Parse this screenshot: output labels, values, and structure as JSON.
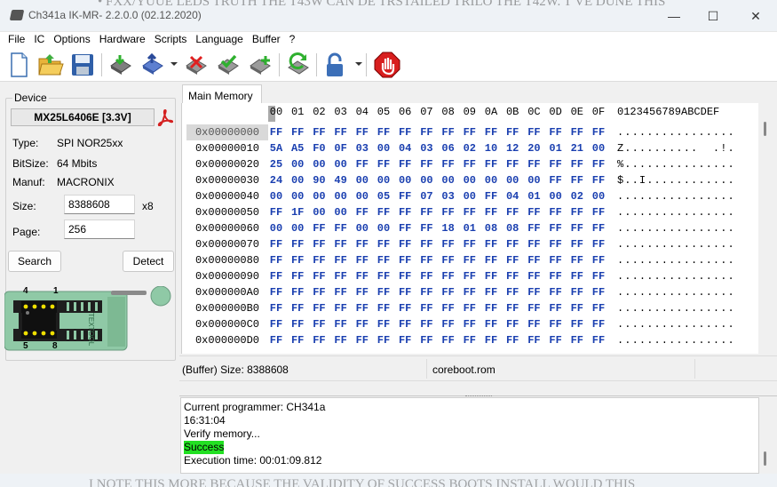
{
  "window": {
    "title": "Ch341a IK-MR- 2.2.0.0 (02.12.2020)",
    "bg_text_top": "• FXX/YUUE LEDS TRUTH THE T43W CAN DE TRSTAILED TRILO THE T42W. T VE DUNE THIS",
    "bg_text_bottom": "I NOTE THIS MORE BECAUSE THE VALIDITY OF SUCCESS BOOTS INSTALL WOULD THIS"
  },
  "menu": [
    "File",
    "IC",
    "Options",
    "Hardware",
    "Scripts",
    "Language",
    "Buffer",
    "?"
  ],
  "toolbar": {
    "icons": [
      "new-file-icon",
      "open-file-icon",
      "save-icon",
      "read-chip-icon",
      "write-chip-icon",
      "erase-chip-icon",
      "verify-chip-icon",
      "blank-check-icon",
      "auto-icon",
      "lock-icon",
      "stop-icon"
    ]
  },
  "device": {
    "legend": "Device",
    "chip": "MX25L6406E [3.3V]",
    "type_label": "Type:",
    "type_value": "SPI NOR",
    "type_suffix": "25xx",
    "bitsize_label": "BitSize:",
    "bitsize_value": "64 Mbits",
    "manuf_label": "Manuf:",
    "manuf_value": "MACRONIX",
    "size_label": "Size:",
    "size_value": "8388608",
    "size_mult": "x8",
    "page_label": "Page:",
    "page_value": "256",
    "search_button": "Search",
    "detect_button": "Detect",
    "socket": {
      "pin4": "4",
      "pin1": "1",
      "pin5": "5",
      "pin8": "8",
      "brand": "TEXTOOL"
    }
  },
  "tabs": [
    "Main Memory"
  ],
  "hex": {
    "columns": [
      "00",
      "01",
      "02",
      "03",
      "04",
      "05",
      "06",
      "07",
      "08",
      "09",
      "0A",
      "0B",
      "0C",
      "0D",
      "0E",
      "0F"
    ],
    "ascii_header": "0123456789ABCDEF",
    "rows": [
      {
        "addr": "0x00000000",
        "bytes": [
          "FF",
          "FF",
          "FF",
          "FF",
          "FF",
          "FF",
          "FF",
          "FF",
          "FF",
          "FF",
          "FF",
          "FF",
          "FF",
          "FF",
          "FF",
          "FF"
        ],
        "ascii": "................"
      },
      {
        "addr": "0x00000010",
        "bytes": [
          "5A",
          "A5",
          "F0",
          "0F",
          "03",
          "00",
          "04",
          "03",
          "06",
          "02",
          "10",
          "12",
          "20",
          "01",
          "21",
          "00"
        ],
        "ascii": "Z..........  .!."
      },
      {
        "addr": "0x00000020",
        "bytes": [
          "25",
          "00",
          "00",
          "00",
          "FF",
          "FF",
          "FF",
          "FF",
          "FF",
          "FF",
          "FF",
          "FF",
          "FF",
          "FF",
          "FF",
          "FF"
        ],
        "ascii": "%..............."
      },
      {
        "addr": "0x00000030",
        "bytes": [
          "24",
          "00",
          "90",
          "49",
          "00",
          "00",
          "00",
          "00",
          "00",
          "00",
          "00",
          "00",
          "00",
          "FF",
          "FF",
          "FF"
        ],
        "ascii": "$..I............"
      },
      {
        "addr": "0x00000040",
        "bytes": [
          "00",
          "00",
          "00",
          "00",
          "00",
          "05",
          "FF",
          "07",
          "03",
          "00",
          "FF",
          "04",
          "01",
          "00",
          "02",
          "00"
        ],
        "ascii": "................"
      },
      {
        "addr": "0x00000050",
        "bytes": [
          "FF",
          "1F",
          "00",
          "00",
          "FF",
          "FF",
          "FF",
          "FF",
          "FF",
          "FF",
          "FF",
          "FF",
          "FF",
          "FF",
          "FF",
          "FF"
        ],
        "ascii": "................"
      },
      {
        "addr": "0x00000060",
        "bytes": [
          "00",
          "00",
          "FF",
          "FF",
          "00",
          "00",
          "FF",
          "FF",
          "18",
          "01",
          "08",
          "08",
          "FF",
          "FF",
          "FF",
          "FF"
        ],
        "ascii": "................"
      },
      {
        "addr": "0x00000070",
        "bytes": [
          "FF",
          "FF",
          "FF",
          "FF",
          "FF",
          "FF",
          "FF",
          "FF",
          "FF",
          "FF",
          "FF",
          "FF",
          "FF",
          "FF",
          "FF",
          "FF"
        ],
        "ascii": "................"
      },
      {
        "addr": "0x00000080",
        "bytes": [
          "FF",
          "FF",
          "FF",
          "FF",
          "FF",
          "FF",
          "FF",
          "FF",
          "FF",
          "FF",
          "FF",
          "FF",
          "FF",
          "FF",
          "FF",
          "FF"
        ],
        "ascii": "................"
      },
      {
        "addr": "0x00000090",
        "bytes": [
          "FF",
          "FF",
          "FF",
          "FF",
          "FF",
          "FF",
          "FF",
          "FF",
          "FF",
          "FF",
          "FF",
          "FF",
          "FF",
          "FF",
          "FF",
          "FF"
        ],
        "ascii": "................"
      },
      {
        "addr": "0x000000A0",
        "bytes": [
          "FF",
          "FF",
          "FF",
          "FF",
          "FF",
          "FF",
          "FF",
          "FF",
          "FF",
          "FF",
          "FF",
          "FF",
          "FF",
          "FF",
          "FF",
          "FF"
        ],
        "ascii": "................"
      },
      {
        "addr": "0x000000B0",
        "bytes": [
          "FF",
          "FF",
          "FF",
          "FF",
          "FF",
          "FF",
          "FF",
          "FF",
          "FF",
          "FF",
          "FF",
          "FF",
          "FF",
          "FF",
          "FF",
          "FF"
        ],
        "ascii": "................"
      },
      {
        "addr": "0x000000C0",
        "bytes": [
          "FF",
          "FF",
          "FF",
          "FF",
          "FF",
          "FF",
          "FF",
          "FF",
          "FF",
          "FF",
          "FF",
          "FF",
          "FF",
          "FF",
          "FF",
          "FF"
        ],
        "ascii": "................"
      },
      {
        "addr": "0x000000D0",
        "bytes": [
          "FF",
          "FF",
          "FF",
          "FF",
          "FF",
          "FF",
          "FF",
          "FF",
          "FF",
          "FF",
          "FF",
          "FF",
          "FF",
          "FF",
          "FF",
          "FF"
        ],
        "ascii": "................"
      }
    ]
  },
  "status": {
    "buffer_size": "(Buffer) Size: 8388608",
    "filename": "coreboot.rom"
  },
  "log": {
    "line1": "Current programmer: CH341a",
    "line2": "16:31:04",
    "line3": "Verify memory...",
    "line4": "Success",
    "line5": "Execution time: 00:01:09.812"
  },
  "colors": {
    "hex_bytes": "#1a3fb0",
    "success_highlight": "#22e022",
    "socket_green": "#8fc9a6"
  }
}
